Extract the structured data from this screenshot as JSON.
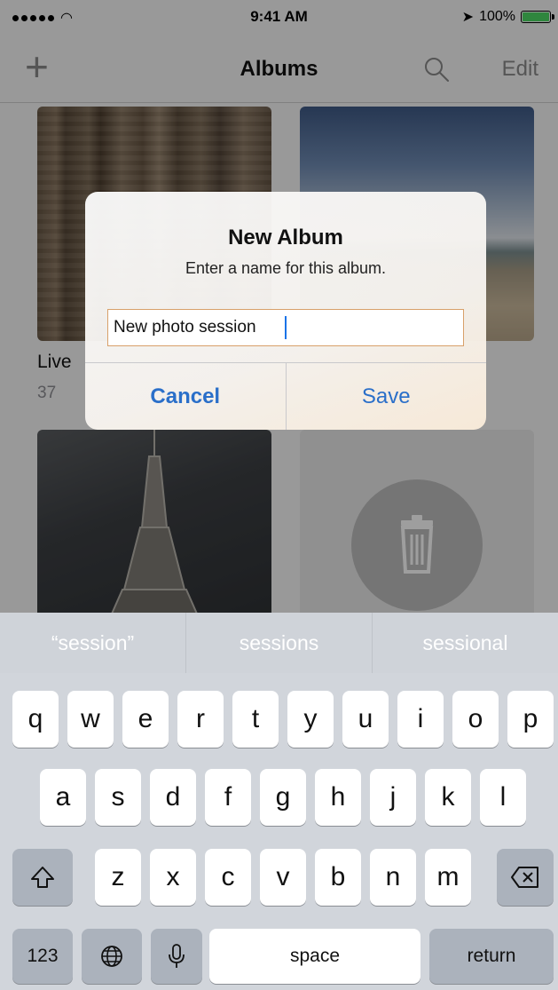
{
  "status_bar": {
    "time": "9:41 AM",
    "battery": "100%",
    "battery_level": 1.0
  },
  "nav_bar": {
    "add_symbol": "+",
    "title": "Albums",
    "edit_label": "Edit"
  },
  "albums": [
    {
      "name": "Live",
      "count": "37"
    }
  ],
  "alert": {
    "title": "New Album",
    "message": "Enter a name for this album.",
    "input_value": "New photo session",
    "cancel_label": "Cancel",
    "save_label": "Save"
  },
  "keyboard": {
    "suggestions": [
      "“session”",
      "sessions",
      "sessional"
    ],
    "row1": [
      "q",
      "w",
      "e",
      "r",
      "t",
      "y",
      "u",
      "i",
      "o",
      "p"
    ],
    "row2": [
      "a",
      "s",
      "d",
      "f",
      "g",
      "h",
      "j",
      "k",
      "l"
    ],
    "row3": [
      "z",
      "x",
      "c",
      "v",
      "b",
      "n",
      "m"
    ],
    "numbers_label": "123",
    "space_label": "space",
    "return_label": "return"
  },
  "colors": {
    "accent": "#2a6fc9",
    "battery": "#4cd964"
  },
  "icons": [
    "signal-icon",
    "wifi-icon",
    "location-icon",
    "battery-icon",
    "search-icon",
    "trash-icon",
    "shift-icon",
    "delete-icon",
    "globe-icon",
    "microphone-icon"
  ]
}
